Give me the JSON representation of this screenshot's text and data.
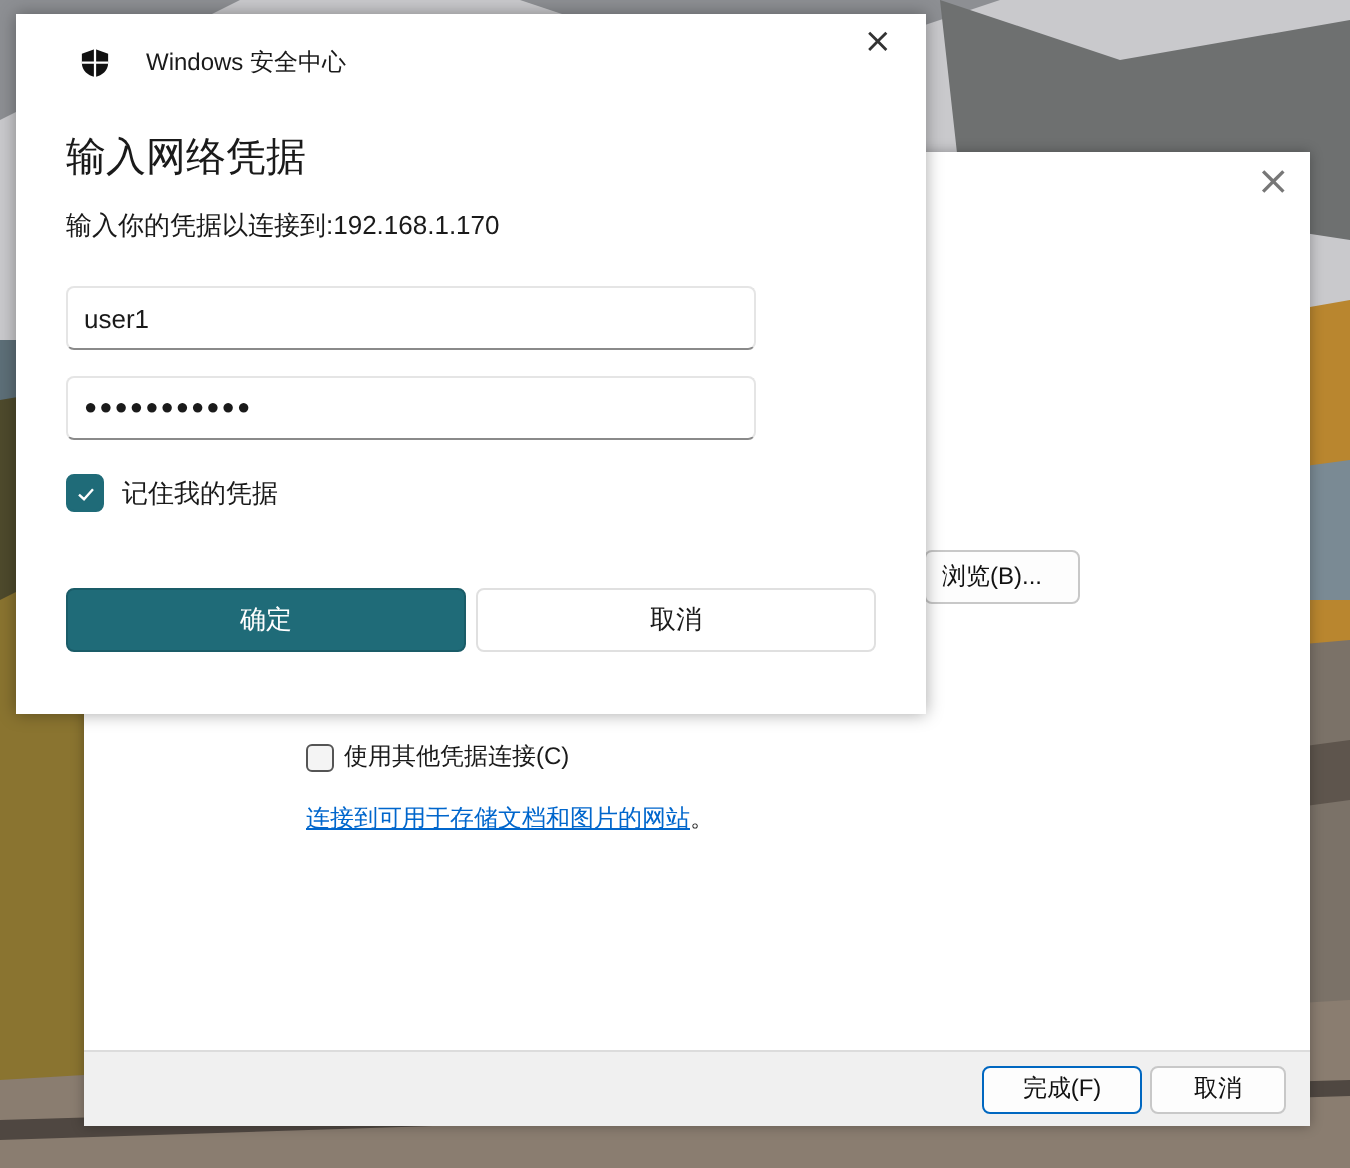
{
  "background_dialog": {
    "close": "×",
    "browse_button": "浏览(B)...",
    "other_credentials": {
      "label": "使用其他凭据连接(C)",
      "checked": false
    },
    "link": "连接到可用于存储文档和图片的网站",
    "link_suffix": "。",
    "buttons": [
      {
        "label": "完成(F)",
        "kind": "default"
      },
      {
        "label": "取消",
        "kind": "normal"
      }
    ]
  },
  "credential_dialog": {
    "app_title": "Windows 安全中心",
    "close": "×",
    "heading": "输入网络凭据",
    "subtitle": "输入你的凭据以连接到:192.168.1.170",
    "username": {
      "value": "user1"
    },
    "password": {
      "value": "●●●●●●●●●●●"
    },
    "remember": {
      "label": "记住我的凭据",
      "checked": true
    },
    "buttons": [
      {
        "label": "确定",
        "kind": "primary"
      },
      {
        "label": "取消",
        "kind": "secondary"
      }
    ]
  }
}
